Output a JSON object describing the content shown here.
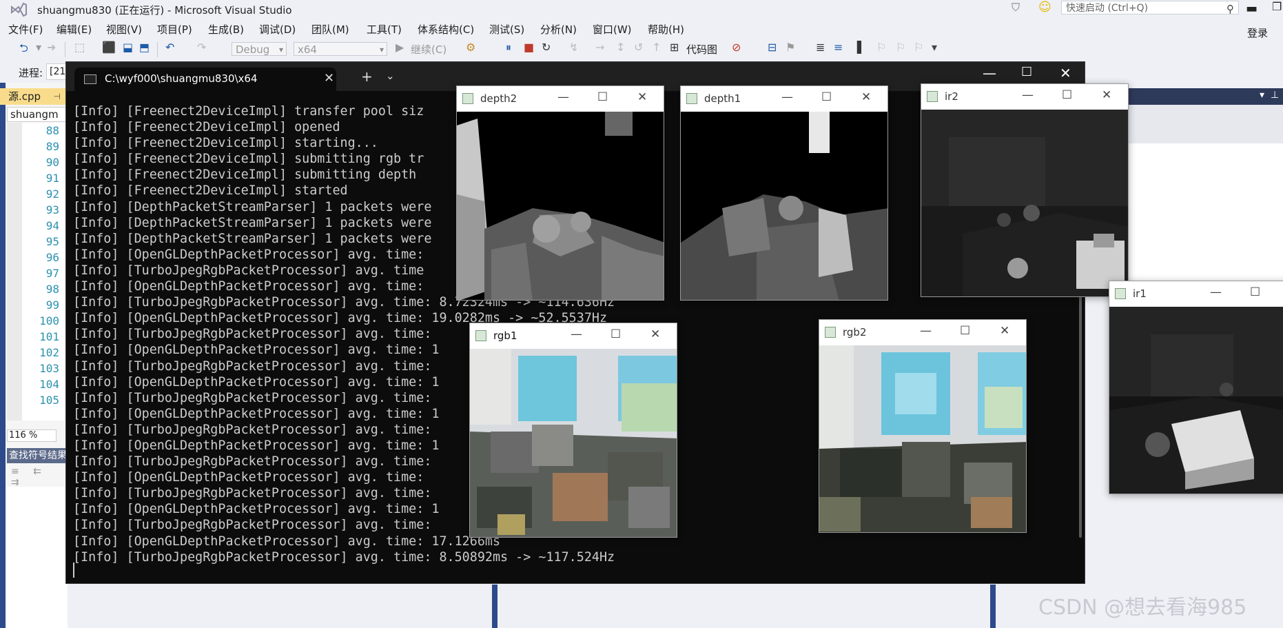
{
  "vs": {
    "title": "shuangmu830 (正在运行) - Microsoft Visual Studio",
    "quick_launch_placeholder": "快速启动 (Ctrl+Q)",
    "login": "登录",
    "menu": [
      "文件(F)",
      "编辑(E)",
      "视图(V)",
      "项目(P)",
      "生成(B)",
      "调试(D)",
      "团队(M)",
      "工具(T)",
      "体系结构(C)",
      "测试(S)",
      "分析(N)",
      "窗口(W)",
      "帮助(H)"
    ],
    "toolbar": {
      "config": "Debug",
      "platform": "x64",
      "continue": "继续(C)",
      "code_map": "代码图"
    },
    "process_label": "进程:",
    "process_value": "[21",
    "editor": {
      "tab": "源.cpp",
      "nav_combo": "shuangm",
      "line_numbers": [
        "88",
        "89",
        "90",
        "91",
        "92",
        "93",
        "94",
        "95",
        "96",
        "97",
        "98",
        "99",
        "100",
        "101",
        "102",
        "103",
        "104",
        "105"
      ],
      "zoom": "116 %",
      "find_panel_title": "查找符号结果"
    },
    "watermark": "CSDN @想去看海985"
  },
  "terminal": {
    "tab_title": "C:\\wyf000\\shuangmu830\\x64",
    "lines": [
      "[Info] [Freenect2DeviceImpl] transfer pool siz",
      "[Info] [Freenect2DeviceImpl] opened",
      "[Info] [Freenect2DeviceImpl] starting...",
      "[Info] [Freenect2DeviceImpl] submitting rgb tr",
      "[Info] [Freenect2DeviceImpl] submitting depth",
      "[Info] [Freenect2DeviceImpl] started",
      "[Info] [DepthPacketStreamParser] 1 packets were",
      "[Info] [DepthPacketStreamParser] 1 packets were",
      "[Info] [DepthPacketStreamParser] 1 packets were",
      "[Info] [OpenGLDepthPacketProcessor] avg. time:",
      "[Info] [TurboJpegRgbPacketProcessor] avg. time",
      "[Info] [OpenGLDepthPacketProcessor] avg. time:",
      "[Info] [TurboJpegRgbPacketProcessor] avg. time: 8.72324ms -> ~114.636Hz",
      "[Info] [OpenGLDepthPacketProcessor] avg. time: 19.0282ms -> ~52.5537Hz",
      "[Info] [TurboJpegRgbPacketProcessor] avg. time:",
      "[Info] [OpenGLDepthPacketProcessor] avg. time: 1",
      "[Info] [TurboJpegRgbPacketProcessor] avg. time:",
      "[Info] [OpenGLDepthPacketProcessor] avg. time: 1",
      "[Info] [TurboJpegRgbPacketProcessor] avg. time:",
      "[Info] [OpenGLDepthPacketProcessor] avg. time: 1",
      "[Info] [TurboJpegRgbPacketProcessor] avg. time:",
      "[Info] [OpenGLDepthPacketProcessor] avg. time: 1",
      "[Info] [TurboJpegRgbPacketProcessor] avg. time:",
      "[Info] [OpenGLDepthPacketProcessor] avg. time:",
      "[Info] [TurboJpegRgbPacketProcessor] avg. time:",
      "[Info] [OpenGLDepthPacketProcessor] avg. time: 1",
      "[Info] [TurboJpegRgbPacketProcessor] avg. time:",
      "[Info] [OpenGLDepthPacketProcessor] avg. time: 17.1266ms",
      "[Info] [TurboJpegRgbPacketProcessor] avg. time: 8.50892ms -> ~117.524Hz"
    ]
  },
  "windows": {
    "depth2": "depth2",
    "depth1": "depth1",
    "ir2": "ir2",
    "ir1": "ir1",
    "rgb1": "rgb1",
    "rgb2": "rgb2"
  }
}
